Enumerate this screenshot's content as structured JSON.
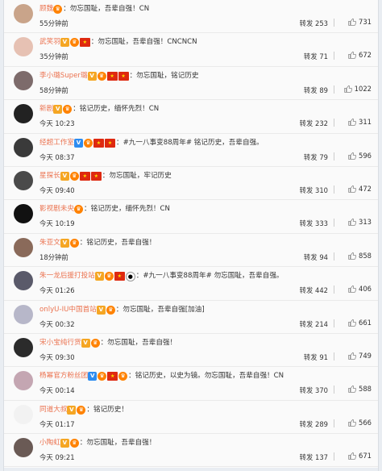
{
  "posts": [
    {
      "name": "顾魏",
      "badges": [
        "vip"
      ],
      "content": "：勿忘国耻，吾辈自强！CN",
      "time": "55分钟前",
      "repost": "转发 253",
      "likes": "731",
      "avatar": "#c9a48a"
    },
    {
      "name": "武笑羽",
      "badges": [
        "v-gold",
        "vip",
        "flag"
      ],
      "content": "：勿忘国耻，吾辈自强！CNCNCN",
      "time": "35分钟前",
      "repost": "转发 71",
      "likes": "672",
      "avatar": "#e6c1b3"
    },
    {
      "name": "李小璐Super璐",
      "badges": [
        "v-gold",
        "vip",
        "flag",
        "flag"
      ],
      "content": "：勿忘国耻，铭记历史",
      "time": "58分钟前",
      "repost": "转发 89",
      "likes": "1022",
      "avatar": "#7d6b6b"
    },
    {
      "name": "新剧",
      "badges": [
        "v-gold",
        "vip"
      ],
      "content": "：铭记历史，缅怀先烈！CN",
      "time": "今天 10:23",
      "repost": "转发 232",
      "likes": "311",
      "avatar": "#222222"
    },
    {
      "name": "经超工作室",
      "badges": [
        "v-blue",
        "vip",
        "flag",
        "flag"
      ],
      "content": "：#九一八事变88周年# 铭记历史，吾辈自强。",
      "time": "今天 08:37",
      "repost": "转发 79",
      "likes": "596",
      "avatar": "#3a3a3a"
    },
    {
      "name": "星探长",
      "badges": [
        "v-gold",
        "vip",
        "flag",
        "flag"
      ],
      "content": "：勿忘国耻，牢记历史",
      "time": "今天 09:40",
      "repost": "转发 310",
      "likes": "472",
      "avatar": "#4a4a4a"
    },
    {
      "name": "影视剧未央",
      "badges": [
        "vip"
      ],
      "content": "：铭记历史，缅怀先烈！CN",
      "time": "今天 10:19",
      "repost": "转发 333",
      "likes": "313",
      "avatar": "#111111"
    },
    {
      "name": "朱亚文",
      "badges": [
        "v-gold",
        "vip"
      ],
      "content": "：铭记历史，吾辈自强！",
      "time": "18分钟前",
      "repost": "转发 94",
      "likes": "858",
      "avatar": "#8a6a5a"
    },
    {
      "name": "朱一龙后援打投站",
      "badges": [
        "v-gold",
        "vip",
        "flag",
        "panda"
      ],
      "content": "：#九一八事变88周年# 勿忘国耻，吾辈自强。",
      "time": "今天 01:26",
      "repost": "转发 442",
      "likes": "406",
      "avatar": "#5a5a6a"
    },
    {
      "name": "onlyU-IU中国首站",
      "badges": [
        "v-gold",
        "vip"
      ],
      "content": "：勿忘国耻，吾辈自强[加油]",
      "time": "今天 00:32",
      "repost": "转发 214",
      "likes": "661",
      "avatar": "#b7b7c9"
    },
    {
      "name": "宋小宝纯行货",
      "badges": [
        "v-gold",
        "vip"
      ],
      "content": "：勿忘国耻，吾辈自强！",
      "time": "今天 09:30",
      "repost": "转发 91",
      "likes": "749",
      "avatar": "#2b2b2b"
    },
    {
      "name": "杨幂官方粉丝团",
      "badges": [
        "v-blue",
        "vip",
        "flag",
        "vip"
      ],
      "content": "：铭记历史，以史为镜。勿忘国耻，吾辈自强！CN",
      "time": "今天 00:14",
      "repost": "转发 370",
      "likes": "588",
      "avatar": "#c4a6b2"
    },
    {
      "name": "同道大叔",
      "badges": [
        "v-gold",
        "vip"
      ],
      "content": "：铭记历史！",
      "time": "今天 01:17",
      "repost": "转发 289",
      "likes": "566",
      "avatar": "#f2f2f2"
    },
    {
      "name": "小陶虹",
      "badges": [
        "v-gold",
        "vip"
      ],
      "content": "：勿忘国耻，吾辈自强！",
      "time": "今天 09:21",
      "repost": "转发 137",
      "likes": "671",
      "avatar": "#6a5a55"
    }
  ],
  "colors": {
    "name": "#eb7350",
    "text": "#333333",
    "background": "#fafafa"
  },
  "icons": {
    "like": "thumbs-up-icon"
  }
}
